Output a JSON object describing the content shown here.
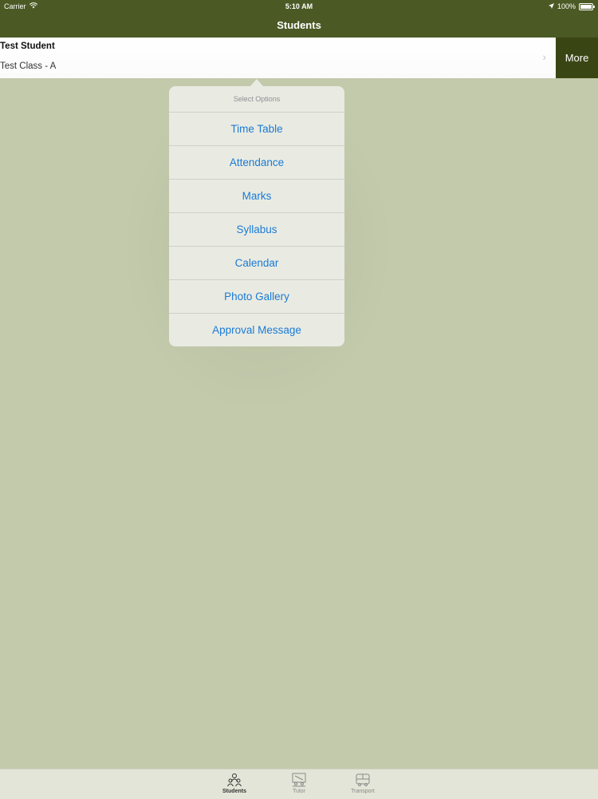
{
  "status_bar": {
    "carrier": "Carrier",
    "time": "5:10 AM",
    "battery": "100%",
    "battery_level": 1.0
  },
  "nav": {
    "title": "Students"
  },
  "student": {
    "name": "Test Student",
    "class": "Test Class - A",
    "more_label": "More"
  },
  "popover": {
    "title": "Select Options",
    "items": [
      "Time Table",
      "Attendance",
      "Marks",
      "Syllabus",
      "Calendar",
      "Photo Gallery",
      "Approval Message"
    ]
  },
  "tabs": [
    {
      "label": "Students",
      "icon": "students-icon",
      "active": true
    },
    {
      "label": "Tutor",
      "icon": "tutor-icon",
      "active": false
    },
    {
      "label": "Transport",
      "icon": "transport-icon",
      "active": false
    }
  ],
  "colors": {
    "header": "#4b5a25",
    "more": "#3a4514",
    "accent": "#1a7ad6",
    "background": "#c3c9ab"
  }
}
